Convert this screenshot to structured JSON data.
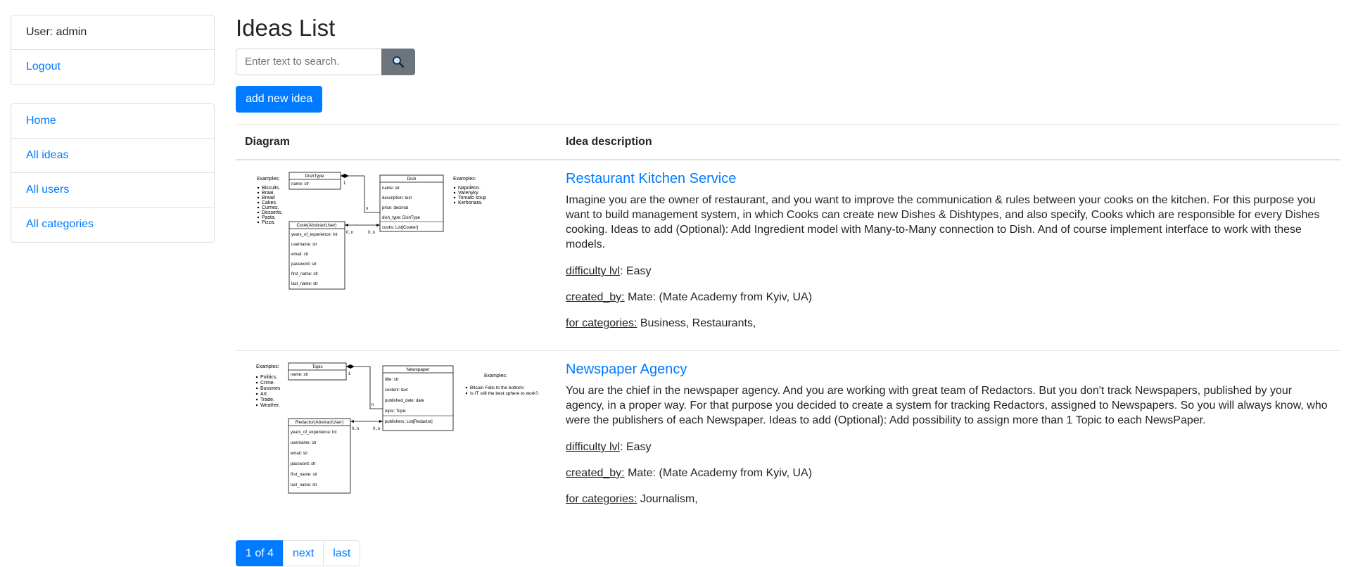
{
  "sidebar": {
    "user_label": "User: admin",
    "logout": "Logout",
    "nav": [
      "Home",
      "All ideas",
      "All users",
      "All categories"
    ]
  },
  "main": {
    "title": "Ideas List",
    "search_placeholder": "Enter text to search.",
    "add_button": "add new idea",
    "headers": {
      "diagram": "Diagram",
      "description": "Idea description"
    }
  },
  "ideas": [
    {
      "title": "Restaurant Kitchen Service",
      "description": "Imagine you are the owner of restaurant, and you want to improve the communication & rules between your cooks on the kitchen. For this purpose you want to build management system, in which Cooks can create new Dishes & Dishtypes, and also specify, Cooks which are responsible for every Dishes cooking. Ideas to add (Optional): Add Ingredient model with Many-to-Many connection to Dish. And of course implement interface to work with these models.",
      "difficulty_label": "difficulty lvl",
      "difficulty": "Easy",
      "created_label": "created_by:",
      "created_by": "Mate: (Mate Academy from Kyiv, UA)",
      "categories_label": "for categories:",
      "categories": "Business, Restaurants,",
      "diagram": {
        "examples_left_title": "Examples:",
        "examples_left": [
          "Biscuits.",
          "Braai.",
          "Bread",
          "Cakes.",
          "Curries.",
          "Desserts.",
          "Pasta.",
          "Pizza."
        ],
        "examples_right_title": "Examples:",
        "examples_right": [
          "Napoleon.",
          "Varenyky.",
          "Tomato soup",
          "Kerbonara."
        ],
        "box_a_title": "DishType",
        "box_a_fields": [
          "name: str"
        ],
        "box_b_title": "Dish",
        "box_b_fields": [
          "name: str",
          "description: text",
          "price: decimal",
          "dish_type: DishType",
          "cooks: List[Cooker]"
        ],
        "box_c_title": "Cook(AbstractUser)",
        "box_c_fields": [
          "years_of_experience: int",
          "username: str",
          "email: str",
          "password: str",
          "first_name: str",
          "last_name: str"
        ],
        "mult_one": "1",
        "mult_n": "n",
        "mult_0n_a": "0..n",
        "mult_0n_b": "0..n"
      }
    },
    {
      "title": "Newspaper Agency",
      "description": "You are the chief in the newspaper agency. And you are working with great team of Redactors. But you don't track Newspapers, published by your agency, in a proper way. For that purpose you decided to create a system for tracking Redactors, assigned to Newspapers. So you will always know, who were the publishers of each Newspaper. Ideas to add (Optional): Add possibility to assign more than 1 Topic to each NewsPaper.",
      "difficulty_label": "difficulty lvl",
      "difficulty": "Easy",
      "created_label": "created_by:",
      "created_by": "Mate: (Mate Academy from Kyiv, UA)",
      "categories_label": "for categories:",
      "categories": "Journalism,",
      "diagram": {
        "examples_left_title": "Examples:",
        "examples_left": [
          "Politics.",
          "Crime.",
          "Bussines",
          "Art.",
          "Trade.",
          "Weather."
        ],
        "examples_right_title": "Examples:",
        "examples_right": [
          "Bitcoin Falls to the bottom!",
          "Is IT still the best sphere to work?."
        ],
        "box_a_title": "Topic",
        "box_a_fields": [
          "name: str"
        ],
        "box_b_title": "Newspaper",
        "box_b_fields": [
          "title: str",
          "content: text",
          "published_date: date",
          "topic: Topic",
          "publishers: List[Redactor]"
        ],
        "box_c_title": "Redactor(AbstractUser)",
        "box_c_fields": [
          "years_of_experience: int",
          "username: str",
          "email: str",
          "password: str",
          "first_name: str",
          "last_name: str"
        ],
        "mult_one": "1",
        "mult_n": "n",
        "mult_0n_a": "0..n",
        "mult_0n_b": "0..n"
      }
    }
  ],
  "pagination": {
    "current": "1 of 4",
    "next": "next",
    "last": "last"
  },
  "colors": {
    "primary": "#007bff",
    "secondary": "#6c757d"
  },
  "icons": {
    "search": "magnifier-icon"
  }
}
